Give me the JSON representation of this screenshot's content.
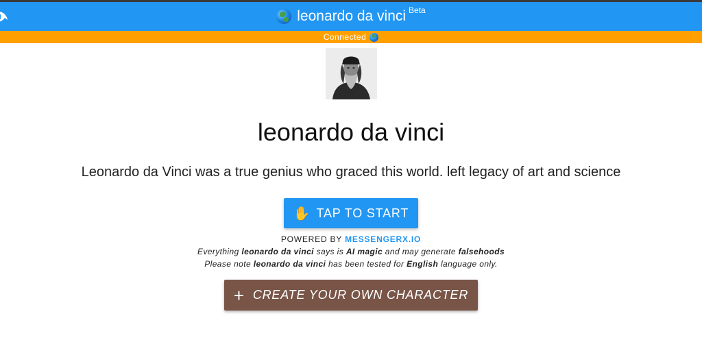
{
  "header": {
    "title": "leonardo da vinci",
    "badge": "Beta",
    "back_icon": "dolphin-back-icon",
    "globe_icon": "globe-icon"
  },
  "status": {
    "text": "Connected",
    "icon": "globe-icon"
  },
  "character": {
    "name": "leonardo da vinci",
    "description": "Leonardo da Vinci was a true genius who graced this world. left legacy of art and science",
    "avatar_icon": "portrait-avatar"
  },
  "start_button": {
    "icon": "✋",
    "label": "TAP TO START"
  },
  "powered_by": {
    "prefix": "POWERED BY",
    "brand": "MESSENGERX.IO"
  },
  "notes": {
    "line1_a": "Everything ",
    "line1_name": "leonardo da vinci",
    "line1_b": " says is ",
    "line1_magic": "AI magic",
    "line1_c": " and may generate ",
    "line1_false": "falsehoods",
    "line2_a": "Please note ",
    "line2_name": "leonardo da vinci",
    "line2_b": " has been tested for ",
    "line2_lang": "English",
    "line2_c": " language only."
  },
  "create_button": {
    "icon": "+",
    "label": "CREATE YOUR OWN CHARACTER"
  },
  "colors": {
    "appbar": "#2196f3",
    "status": "#ffa000",
    "create": "#795548",
    "brand": "#2196f3"
  }
}
